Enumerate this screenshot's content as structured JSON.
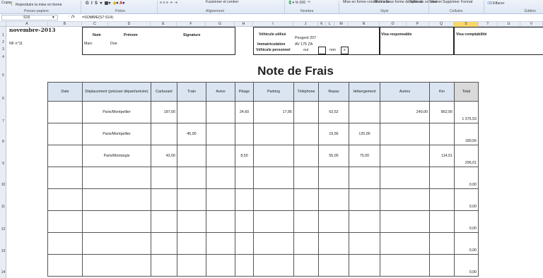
{
  "ribbon": {
    "copy_label": "Copier",
    "format_painter_label": "Reproduire la mise en forme",
    "clipboard_group": "Presse-papiers",
    "font_group": "Police",
    "merge_label": "Fusionner et centrer",
    "alignment_group": "Alignement",
    "number_group": "Nombre",
    "conditional_label": "Mise en forme conditionnelle",
    "table_label": "Mettre sous forme de tableau",
    "styles_label": "Styles de cellules",
    "style_group": "Style",
    "insert_label": "Insérer",
    "delete_label": "Supprimer",
    "format_label": "Format",
    "cells_group": "Cellules",
    "clear_label": "Effacer",
    "edition_group": "Édition"
  },
  "formula_bar": {
    "cell_ref": "S16",
    "fx": "fx",
    "formula": "=SOMME(S7:S14)"
  },
  "columns": [
    "A",
    "B",
    "C",
    "D",
    "E",
    "F",
    "G",
    "H",
    "I",
    "J",
    "K",
    "L",
    "M",
    "N",
    "O",
    "P",
    "Q",
    "S",
    "T",
    "U",
    "V"
  ],
  "rows": [
    "1",
    "2",
    "3",
    "4",
    "5",
    "6",
    "7",
    "8",
    "9",
    "10",
    "11",
    "12",
    "13",
    "14"
  ],
  "header": {
    "month": "novembre-2013",
    "nf": "NF n°11",
    "nom_label": "Nom",
    "prenom_label": "Prénom",
    "signature_label": "Signature",
    "nom_value": "Marc",
    "prenom_value": "Doe",
    "vehicule_label": "Véhicule utilisé",
    "vehicule_value": "Peugeot 207",
    "immat_label": "Immatriculation",
    "immat_value": "AV 175 ZA",
    "perso_label": "Véhicule personnel",
    "oui": "oui",
    "non": "non",
    "x": "x",
    "visa_resp": "Visa responsable",
    "visa_compta": "Visa comptabilité"
  },
  "title": "Note de Frais",
  "table": {
    "headers": [
      "Date",
      "Déplacement (préciser départ/arrivée)",
      "Carburant",
      "Train",
      "Avion",
      "Péage",
      "Parking",
      "Téléphone",
      "Repas",
      "Hébergement",
      "Autres",
      "Km",
      "Total"
    ],
    "rows": [
      [
        "",
        "Paris/Montpellier",
        "187,00",
        "",
        "",
        "24,60",
        "17,85",
        "",
        "63,52",
        "",
        "240,00",
        "862,56",
        "1 375,53"
      ],
      [
        "",
        "Paris/Montpellier",
        "",
        "45,00",
        "",
        "",
        "",
        "",
        "19,56",
        "125,00",
        "",
        "",
        "189,56"
      ],
      [
        "",
        "Paris/Montargis",
        "43,00",
        "",
        "",
        "8,50",
        "",
        "",
        "55,00",
        "75,00",
        "",
        "114,51",
        "296,01"
      ],
      [
        "",
        "",
        "",
        "",
        "",
        "",
        "",
        "",
        "",
        "",
        "",
        "",
        "0,00"
      ],
      [
        "",
        "",
        "",
        "",
        "",
        "",
        "",
        "",
        "",
        "",
        "",
        "",
        "0,00"
      ],
      [
        "",
        "",
        "",
        "",
        "",
        "",
        "",
        "",
        "",
        "",
        "",
        "",
        "0,00"
      ],
      [
        "",
        "",
        "",
        "",
        "",
        "",
        "",
        "",
        "",
        "",
        "",
        "",
        "0,00"
      ],
      [
        "",
        "",
        "",
        "",
        "",
        "",
        "",
        "",
        "",
        "",
        "",
        "",
        "0,00"
      ]
    ]
  }
}
